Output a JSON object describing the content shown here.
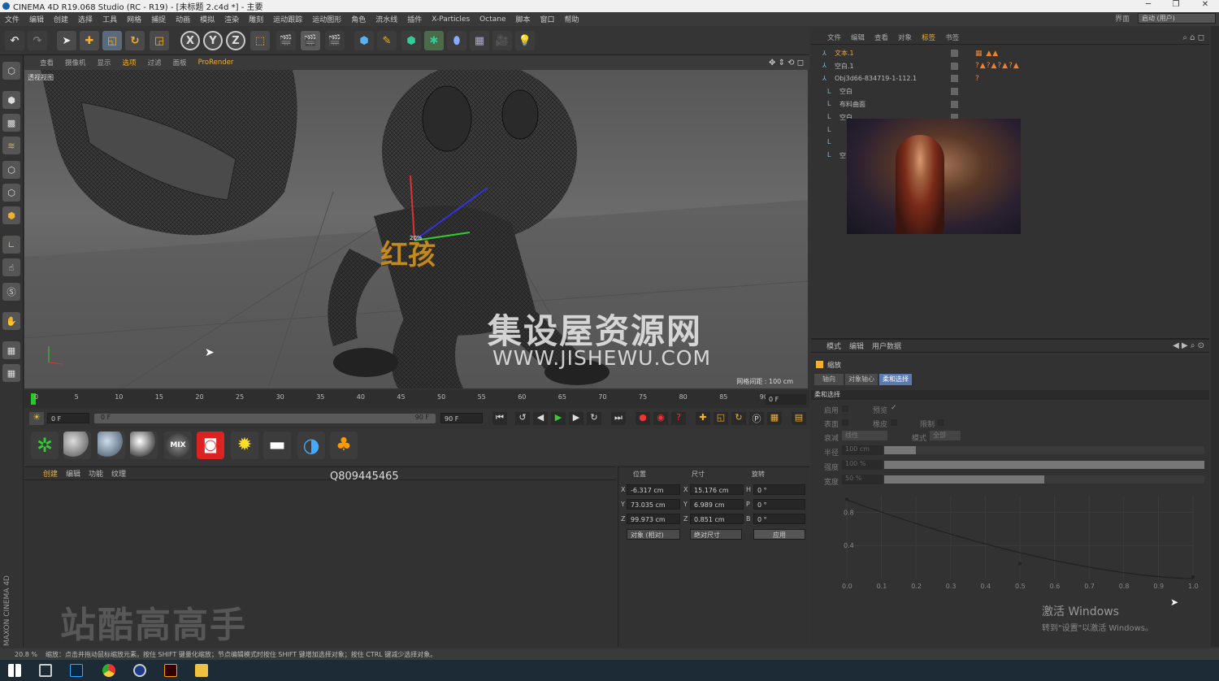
{
  "window": {
    "title": "CINEMA 4D R19.068 Studio (RC - R19) - [未标题 2.c4d *] - 主要",
    "controls": [
      "─",
      "❐",
      "✕"
    ]
  },
  "menubar": {
    "items": [
      "文件",
      "编辑",
      "创建",
      "选择",
      "工具",
      "网格",
      "捕捉",
      "动画",
      "模拟",
      "渲染",
      "雕刻",
      "运动跟踪",
      "运动图形",
      "角色",
      "流水线",
      "插件",
      "X-Particles",
      "Octane",
      "脚本",
      "窗口",
      "帮助"
    ],
    "layout_label": "界面",
    "layout_value": "启动 (用户)"
  },
  "toolbar": {
    "axis_x": "X",
    "axis_y": "Y",
    "axis_z": "Z"
  },
  "viewport": {
    "menu": [
      "查看",
      "摄像机",
      "显示",
      "选项",
      "过滤",
      "面板",
      "ProRender"
    ],
    "label": "透视视图",
    "grid_spacing": "网格间距 : 100 cm",
    "watermark_cn": "集设屋资源网",
    "watermark_url": "WWW.JISHEWU.COM",
    "tag_text": "红孩",
    "tag_small": "20%"
  },
  "timeline": {
    "ticks": [
      "0",
      "5",
      "10",
      "15",
      "20",
      "25",
      "30",
      "35",
      "40",
      "45",
      "50",
      "55",
      "60",
      "65",
      "70",
      "75",
      "80",
      "85",
      "90"
    ],
    "end_frame": "0 F"
  },
  "transport": {
    "current": "0 F",
    "range_start": "0 F",
    "range_end": "90 F",
    "max": "90 F"
  },
  "materials": {
    "mix_label": "MIX"
  },
  "matmgr": {
    "menu": [
      "创建",
      "编辑",
      "功能",
      "纹理"
    ],
    "qq": "Q809445465",
    "watermark": "站酷高高手",
    "brand": "MAXON CINEMA 4D"
  },
  "coords": {
    "headers": [
      "位置",
      "尺寸",
      "旋转"
    ],
    "rows": [
      {
        "axis": "X",
        "pos": "-6.317 cm",
        "size_axis": "X",
        "size": "15.176 cm",
        "rot_axis": "H",
        "rot": "0 °"
      },
      {
        "axis": "Y",
        "pos": "73.035 cm",
        "size_axis": "Y",
        "size": "6.989 cm",
        "rot_axis": "P",
        "rot": "0 °"
      },
      {
        "axis": "Z",
        "pos": "99.973 cm",
        "size_axis": "Z",
        "size": "0.851 cm",
        "rot_axis": "B",
        "rot": "0 °"
      }
    ],
    "mode_select": "对象 (相对)",
    "size_select": "绝对尺寸",
    "apply": "应用"
  },
  "objects": {
    "menu": [
      "文件",
      "编辑",
      "查看",
      "对象",
      "标签",
      "书签"
    ],
    "rows": [
      {
        "name": "文本.1",
        "color": "#e8a040"
      },
      {
        "name": "空白.1",
        "color": "#bbb"
      },
      {
        "name": "Obj3d66-834719-1-112.1",
        "color": "#bbb"
      },
      {
        "name": "空白",
        "color": "#bbb"
      },
      {
        "name": "布料曲面",
        "color": "#bbb"
      },
      {
        "name": "空白",
        "color": "#bbb"
      },
      {
        "name": "",
        "color": "#bbb"
      },
      {
        "name": "",
        "color": "#bbb"
      },
      {
        "name": "空白",
        "color": "#bbb"
      }
    ]
  },
  "attributes": {
    "menu": [
      "模式",
      "编辑",
      "用户数据"
    ],
    "title": "缩放",
    "tabs": [
      "轴向",
      "对象轴心",
      "柔和选择"
    ],
    "section": "柔和选择",
    "fields": [
      {
        "label": "启用",
        "value": ""
      },
      {
        "label": "预览",
        "value": "✓"
      },
      {
        "label": "表面",
        "value": ""
      },
      {
        "label": "橡皮",
        "value": ""
      },
      {
        "label": "限制",
        "value": ""
      }
    ],
    "mode1_label": "衰减",
    "mode1_value": "线性",
    "mode2_label": "模式",
    "mode2_value": "全部",
    "radius_label": "半径",
    "radius_value": "100 cm",
    "strength_label": "强度",
    "strength_value": "100 %",
    "width_label": "宽度",
    "width_value": "50 %",
    "curve_y": [
      "0.8",
      "0.4"
    ],
    "curve_x": [
      "0.0",
      "0.1",
      "0.2",
      "0.3",
      "0.4",
      "0.5",
      "0.6",
      "0.7",
      "0.8",
      "0.9",
      "1.0"
    ],
    "windows_title": "激活 Windows",
    "windows_sub": "转到\"设置\"以激活 Windows。"
  },
  "status": {
    "zoom": "20.8 %",
    "text": "缩放：点击并拖动鼠标缩放元素。按住 SHIFT 键量化缩放；节点编辑模式时按住 SHIFT 键增加选择对象；按住 CTRL 键减少选择对象。"
  }
}
